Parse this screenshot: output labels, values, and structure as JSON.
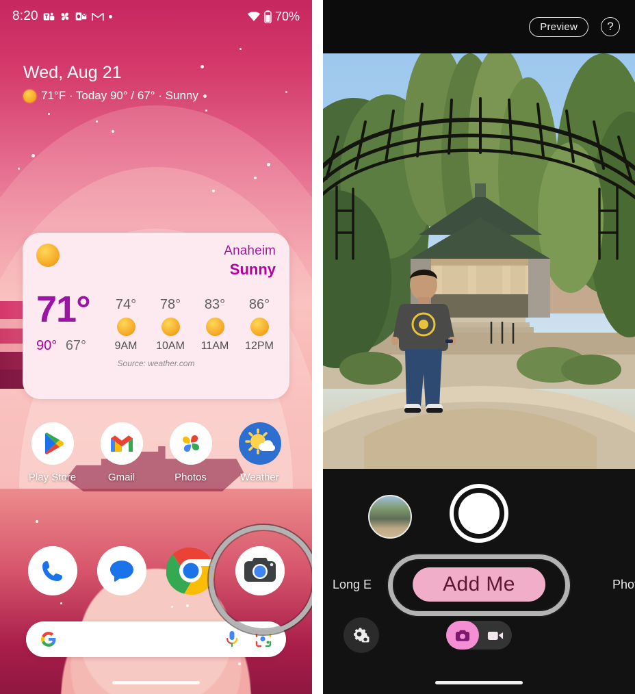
{
  "left_phone": {
    "status_bar": {
      "time": "8:20",
      "icons": [
        "teams-icon",
        "drive-icon",
        "outlook-icon",
        "gmail-icon",
        "more-dot-icon"
      ],
      "wifi": "wifi-icon",
      "battery_icon": "battery-icon",
      "battery": "70%"
    },
    "date_header": {
      "date": "Wed, Aug 21",
      "weather_summary": "71°F  · Today 90° / 67° · Sunny"
    },
    "weather_widget": {
      "city": "Anaheim",
      "condition": "Sunny",
      "current_temp": "71°",
      "high": "90°",
      "low": "67°",
      "hourly": [
        {
          "temp": "74°",
          "time": "9AM",
          "icon": "sunny-icon"
        },
        {
          "temp": "78°",
          "time": "10AM",
          "icon": "sunny-icon"
        },
        {
          "temp": "83°",
          "time": "11AM",
          "icon": "sunny-icon"
        },
        {
          "temp": "86°",
          "time": "12PM",
          "icon": "sunny-icon"
        }
      ],
      "source": "Source: weather.com"
    },
    "apps": [
      {
        "label": "Play Store",
        "icon": "play-store-icon"
      },
      {
        "label": "Gmail",
        "icon": "gmail-icon"
      },
      {
        "label": "Photos",
        "icon": "google-photos-icon"
      },
      {
        "label": "Weather",
        "icon": "weather-icon"
      }
    ],
    "dock": [
      {
        "name": "phone-icon"
      },
      {
        "name": "messages-icon"
      },
      {
        "name": "chrome-icon"
      },
      {
        "name": "camera-icon"
      }
    ],
    "search_bar": {
      "logo": "google-g-icon",
      "placeholder": "",
      "value": "",
      "mic": "microphone-icon",
      "lens": "google-lens-icon"
    },
    "annotation": {
      "target": "camera-icon",
      "color": "#b3b3b3"
    }
  },
  "right_phone": {
    "top_bar": {
      "preview_label": "Preview",
      "help_label": "?"
    },
    "viewfinder": {
      "description": "Park scene with metal arch trellis, gazebo, trees and a person standing"
    },
    "controls": {
      "thumbnail": "gallery-thumbnail",
      "shutter": "shutter-button",
      "modes": [
        {
          "label": "Long E",
          "active": false
        },
        {
          "label": "Add Me",
          "active": true
        },
        {
          "label": "Photo",
          "active": false
        }
      ],
      "settings_icon": "camera-settings-icon",
      "photo_video_toggle": {
        "photo": "photo-mode-icon",
        "video": "video-mode-icon",
        "selected": "photo"
      }
    },
    "annotation": {
      "target": "Add Me",
      "color": "#b3b3b3"
    }
  },
  "colors": {
    "accent_pink": "#f0aec9",
    "widget_bg": "#fdeaf1",
    "widget_purple": "#b4009e",
    "annotation": "#b3b3b3"
  }
}
